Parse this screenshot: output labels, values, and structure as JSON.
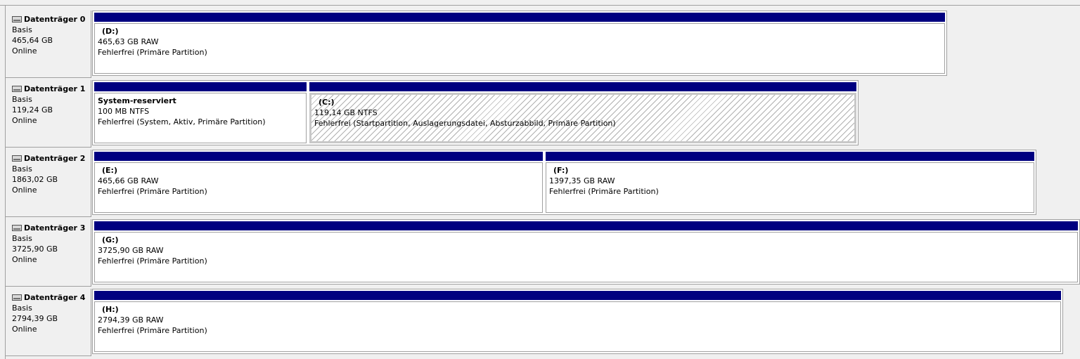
{
  "disks": [
    {
      "title": "Datenträger 0",
      "type": "Basis",
      "size": "465,64 GB",
      "status": "Online",
      "partitions": [
        {
          "name": "(D:)",
          "size": "465,63 GB RAW",
          "status": "Fehlerfrei (Primäre Partition)"
        }
      ]
    },
    {
      "title": "Datenträger 1",
      "type": "Basis",
      "size": "119,24 GB",
      "status": "Online",
      "partitions": [
        {
          "name": "System-reserviert",
          "size": "100 MB NTFS",
          "status": "Fehlerfrei (System, Aktiv, Primäre Partition)"
        },
        {
          "name": "(C:)",
          "size": "119,14 GB NTFS",
          "status": "Fehlerfrei (Startpartition, Auslagerungsdatei, Absturzabbild, Primäre Partition)"
        }
      ]
    },
    {
      "title": "Datenträger 2",
      "type": "Basis",
      "size": "1863,02 GB",
      "status": "Online",
      "partitions": [
        {
          "name": "(E:)",
          "size": "465,66 GB RAW",
          "status": "Fehlerfrei (Primäre Partition)"
        },
        {
          "name": "(F:)",
          "size": "1397,35 GB RAW",
          "status": "Fehlerfrei (Primäre Partition)"
        }
      ]
    },
    {
      "title": "Datenträger 3",
      "type": "Basis",
      "size": "3725,90 GB",
      "status": "Online",
      "partitions": [
        {
          "name": "(G:)",
          "size": "3725,90 GB RAW",
          "status": "Fehlerfrei (Primäre Partition)"
        }
      ]
    },
    {
      "title": "Datenträger 4",
      "type": "Basis",
      "size": "2794,39 GB",
      "status": "Online",
      "partitions": [
        {
          "name": "(H:)",
          "size": "2794,39 GB RAW",
          "status": "Fehlerfrei (Primäre Partition)"
        }
      ]
    }
  ],
  "colors": {
    "partition_bar": "#000080",
    "border": "#a0a0a0",
    "background": "#f0f0f0"
  },
  "icons": {
    "disk": "hard-disk-icon"
  }
}
